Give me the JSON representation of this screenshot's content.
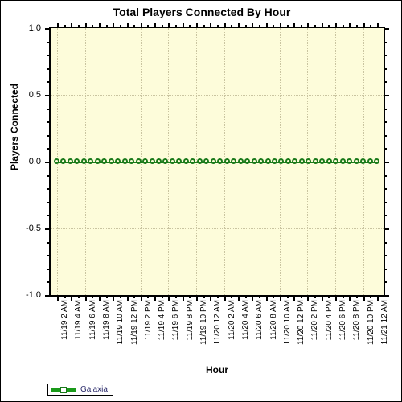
{
  "chart_data": {
    "type": "line",
    "title": "Total Players Connected By Hour",
    "xlabel": "Hour",
    "ylabel": "Players Connected",
    "ylim": [
      -1.0,
      1.0
    ],
    "ytick_labels": [
      "1.0",
      "0.5",
      "0.0",
      "-0.5",
      "-1.0"
    ],
    "ytick_values": [
      1.0,
      0.5,
      0.0,
      -0.5,
      -1.0
    ],
    "yminor_count": 4,
    "grid": true,
    "grid_style": "dotted",
    "legend_position": "bottom-left",
    "categories": [
      "11/19 2 AM",
      "11/19 4 AM",
      "11/19 6 AM",
      "11/19 8 AM",
      "11/19 10 AM",
      "11/19 12 PM",
      "11/19 2 PM",
      "11/19 4 PM",
      "11/19 6 PM",
      "11/19 8 PM",
      "11/19 10 PM",
      "11/20 12 AM",
      "11/20 2 AM",
      "11/20 4 AM",
      "11/20 6 AM",
      "11/20 8 AM",
      "11/20 10 AM",
      "11/20 12 PM",
      "11/20 2 PM",
      "11/20 4 PM",
      "11/20 6 PM",
      "11/20 8 PM",
      "11/20 10 PM",
      "11/21 12 AM"
    ],
    "series": [
      {
        "name": "Galaxia",
        "color": "#1a7a1a",
        "values": [
          0,
          0,
          0,
          0,
          0,
          0,
          0,
          0,
          0,
          0,
          0,
          0,
          0,
          0,
          0,
          0,
          0,
          0,
          0,
          0,
          0,
          0,
          0,
          0,
          0,
          0,
          0,
          0,
          0,
          0,
          0,
          0,
          0,
          0,
          0,
          0,
          0,
          0,
          0,
          0,
          0,
          0,
          0,
          0,
          0,
          0,
          0,
          0
        ]
      }
    ],
    "plot_background": "#fdfcda",
    "axis_color": "#000000"
  },
  "legend": {
    "entries": [
      {
        "label": "Galaxia",
        "color": "#1a9a1a"
      }
    ]
  }
}
